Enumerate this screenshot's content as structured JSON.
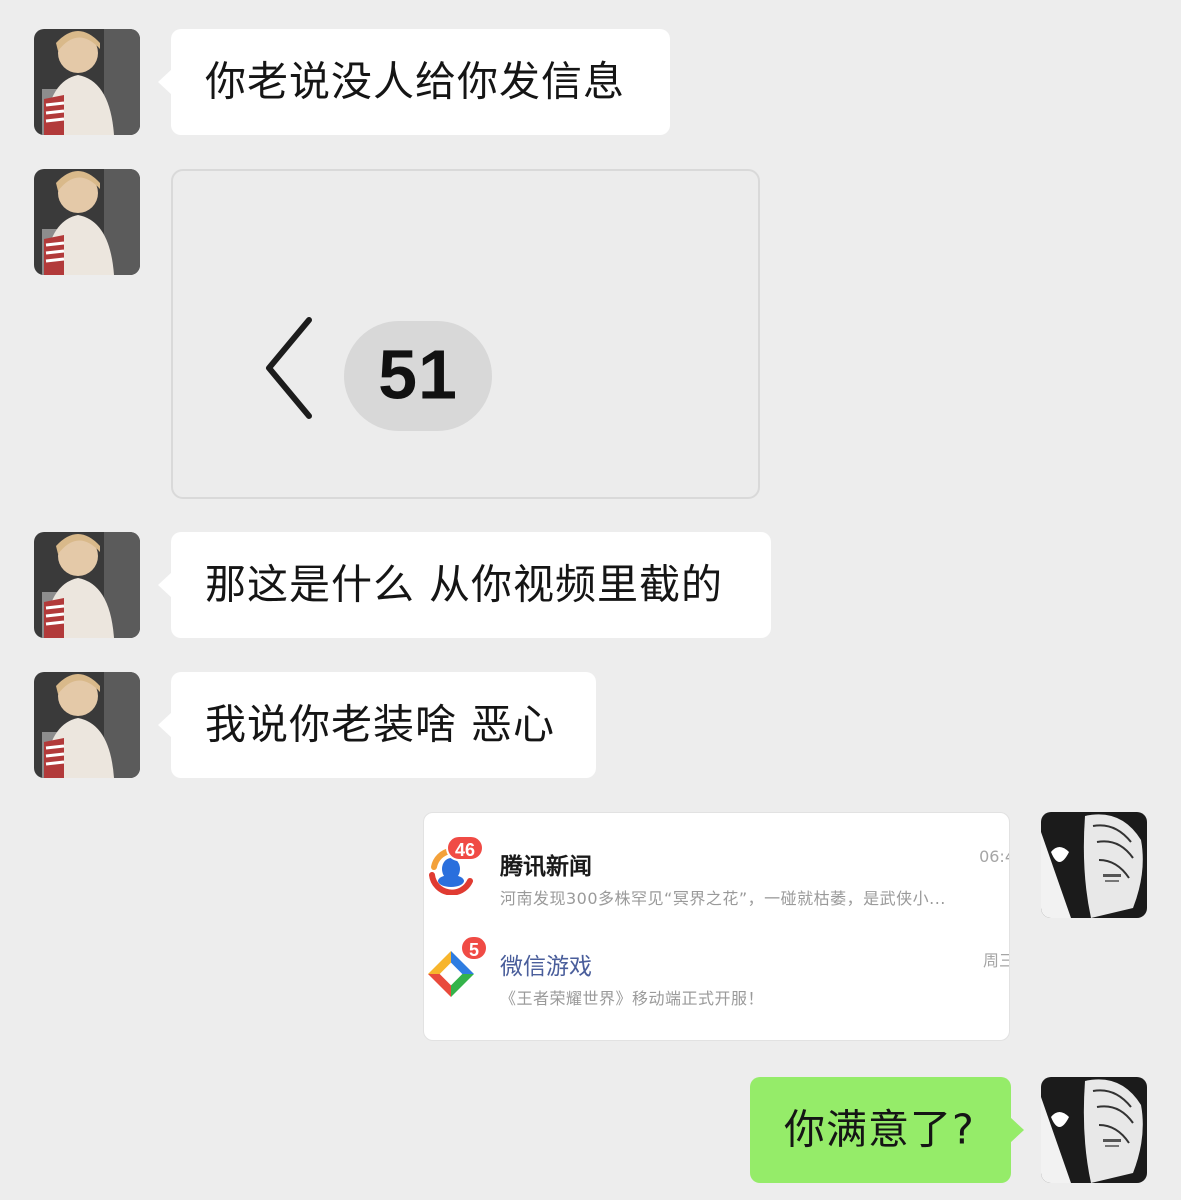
{
  "messages": [
    {
      "sender": "other",
      "type": "text",
      "text": "你老说没人给你发信息"
    },
    {
      "sender": "other",
      "type": "image",
      "back_icon": "chevron-left-icon",
      "unread_count": "51"
    },
    {
      "sender": "other",
      "type": "text",
      "text": "那这是什么 从你视频里截的"
    },
    {
      "sender": "other",
      "type": "text",
      "text": "我说你老装啥 恶心"
    },
    {
      "sender": "me",
      "type": "image",
      "notifications": [
        {
          "app": "腾讯新闻",
          "badge": "46",
          "preview": "河南发现300多株罕见“冥界之花”，一碰就枯萎，是武侠小...",
          "time": "06:4",
          "icon": "tencent-news-icon"
        },
        {
          "app": "微信游戏",
          "badge": "5",
          "preview": "《王者荣耀世界》移动端正式开服！",
          "time": "周三",
          "icon": "wechat-games-icon"
        }
      ]
    },
    {
      "sender": "me",
      "type": "text",
      "text": "你满意了?"
    }
  ],
  "colors": {
    "background": "#ededed",
    "my_bubble": "#95ec69",
    "other_bubble": "#ffffff",
    "badge": "#f04b45"
  }
}
